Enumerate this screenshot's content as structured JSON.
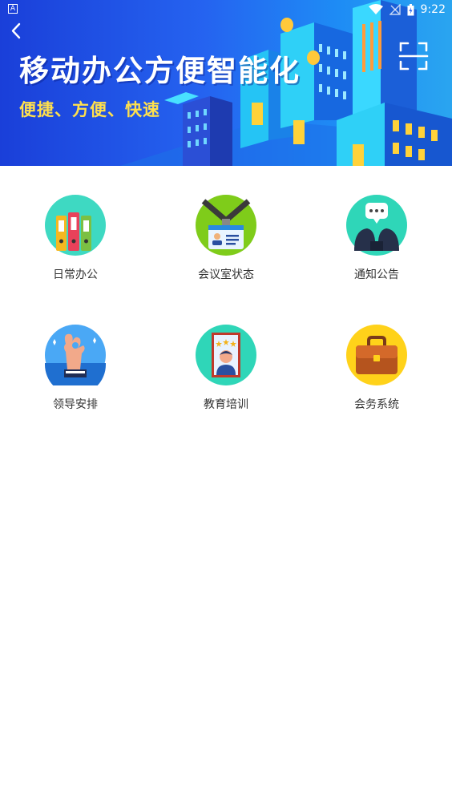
{
  "status_bar": {
    "left_icon": "A",
    "time": "9:22",
    "icons": [
      "wifi-icon",
      "signal-icon",
      "battery-icon"
    ]
  },
  "banner": {
    "title": "移动办公方便智能化",
    "subtitle": "便捷、方便、快速",
    "back_icon": "chevron-left-icon",
    "scan_icon": "scan-icon",
    "colors": {
      "background_start": "#1a3fd9",
      "background_end": "#2aa5f0",
      "subtitle": "#ffe04d"
    }
  },
  "grid": {
    "items": [
      {
        "label": "日常办公",
        "icon": "binders-icon",
        "icon_color": "#3ed9c2"
      },
      {
        "label": "会议室状态",
        "icon": "id-badge-icon",
        "icon_color": "#7fcc1a"
      },
      {
        "label": "通知公告",
        "icon": "chat-people-icon",
        "icon_color": "#2fd6b8"
      },
      {
        "label": "领导安排",
        "icon": "ok-hand-icon",
        "icon_color": "#4aa8f5"
      },
      {
        "label": "教育培训",
        "icon": "certificate-icon",
        "icon_color": "#2fd6b8"
      },
      {
        "label": "会务系统",
        "icon": "briefcase-icon",
        "icon_color": "#ffd21a"
      }
    ]
  }
}
